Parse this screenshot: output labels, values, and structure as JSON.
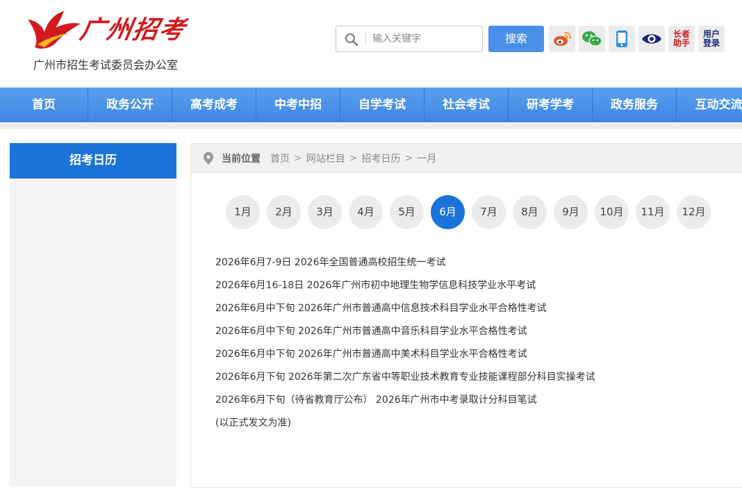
{
  "header": {
    "logo_script": "广州招考",
    "logo_subtitle": "广州市招生考试委员会办公室",
    "search_placeholder": "输入关键字",
    "search_button": "搜索",
    "tools": [
      {
        "icon": "weibo-icon",
        "color": "#e8542a"
      },
      {
        "icon": "wechat-icon",
        "color": "#3aa84a"
      },
      {
        "icon": "mobile-icon",
        "color": "#2f8ee0"
      },
      {
        "icon": "eye-icon",
        "color": "#1b2a7a"
      },
      {
        "icon": "elder-helper-icon",
        "label": "长者助手",
        "color": "#d2191f"
      },
      {
        "icon": "user-login-icon",
        "label": "用户登录",
        "color": "#1b2a7a"
      }
    ]
  },
  "nav": {
    "items": [
      "首页",
      "政务公开",
      "高考成考",
      "中考中招",
      "自学考试",
      "社会考试",
      "研考学考",
      "政务服务",
      "互动交流"
    ]
  },
  "sidebar": {
    "title": "招考日历"
  },
  "breadcrumb": {
    "label": "当前位置",
    "items": [
      "首页",
      "网站栏目",
      "招考日历",
      "一月"
    ],
    "separator": ">"
  },
  "months": {
    "items": [
      "1月",
      "2月",
      "3月",
      "4月",
      "5月",
      "6月",
      "7月",
      "8月",
      "9月",
      "10月",
      "11月",
      "12月"
    ],
    "active": "6月"
  },
  "events": [
    "2026年6月7-9日 2026年全国普通高校招生统一考试",
    "2026年6月16-18日 2026年广州市初中地理生物学信息科技学业水平考试",
    "2026年6月中下旬 2026年广州市普通高中信息技术科目学业水平合格性考试",
    "2026年6月中下旬 2026年广州市普通高中音乐科目学业水平合格性考试",
    "2026年6月中下旬 2026年广州市普通高中美术科目学业水平合格性考试",
    "2026年6月下旬 2026年第二次广东省中等职业技术教育专业技能课程部分科目实操考试",
    "2026年6月下旬（待省教育厅公布） 2026年广州市中考录取计分科目笔试",
    "(以正式发文为准)"
  ],
  "colors": {
    "brand_red": "#d2191f",
    "nav_blue": "#4a90e8",
    "active_blue": "#1a73d9"
  }
}
